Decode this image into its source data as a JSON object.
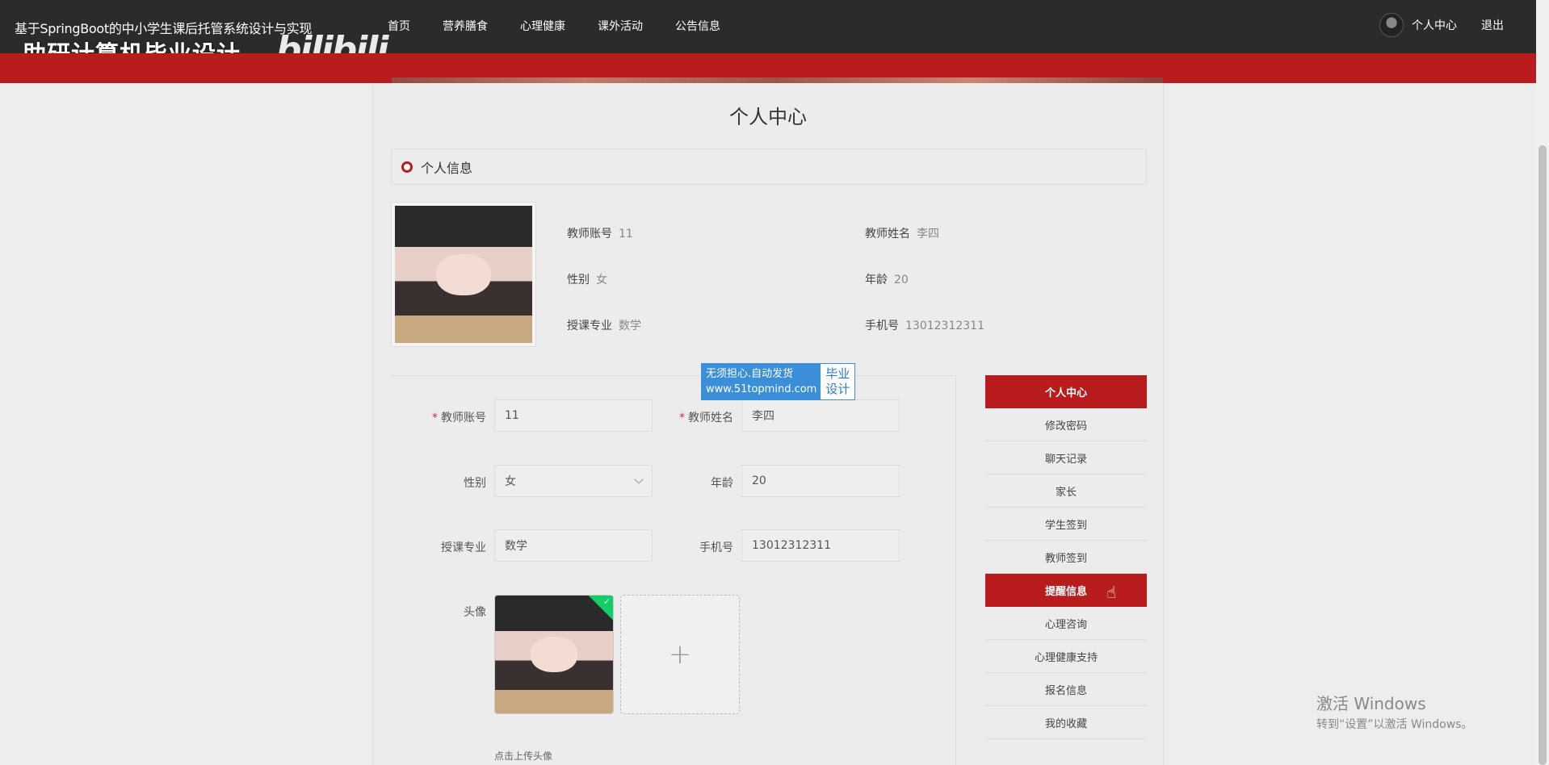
{
  "header": {
    "site_title": "基于SpringBoot的中小学生课后托管系统设计与实现",
    "overlay_watermark": "助研计算机毕业设计",
    "overlay_logo": "bilibili",
    "nav": [
      "首页",
      "营养膳食",
      "心理健康",
      "课外活动",
      "公告信息"
    ],
    "user_center": "个人中心",
    "logout": "退出"
  },
  "page": {
    "title": "个人中心",
    "section_title": "个人信息"
  },
  "info": {
    "account_label": "教师账号",
    "account_value": "11",
    "name_label": "教师姓名",
    "name_value": "李四",
    "gender_label": "性别",
    "gender_value": "女",
    "age_label": "年龄",
    "age_value": "20",
    "major_label": "授课专业",
    "major_value": "数学",
    "phone_label": "手机号",
    "phone_value": "13012312311"
  },
  "form": {
    "account_label": "教师账号",
    "account_value": "11",
    "name_label": "教师姓名",
    "name_value": "李四",
    "gender_label": "性别",
    "gender_value": "女",
    "age_label": "年龄",
    "age_value": "20",
    "major_label": "授课专业",
    "major_value": "数学",
    "phone_label": "手机号",
    "phone_value": "13012312311",
    "avatar_label": "头像",
    "upload_hint": "点击上传头像",
    "add_symbol": "+"
  },
  "ad_badge": {
    "line1": "无须担心.自动发货",
    "line2": "www.51topmind.com",
    "right1": "毕业",
    "right2": "设计"
  },
  "side_menu": [
    {
      "label": "个人中心",
      "active": true
    },
    {
      "label": "修改密码",
      "active": false
    },
    {
      "label": "聊天记录",
      "active": false
    },
    {
      "label": "家长",
      "active": false
    },
    {
      "label": "学生签到",
      "active": false
    },
    {
      "label": "教师签到",
      "active": false
    },
    {
      "label": "提醒信息",
      "active": true
    },
    {
      "label": "心理咨询",
      "active": false
    },
    {
      "label": "心理健康支持",
      "active": false
    },
    {
      "label": "报名信息",
      "active": false
    },
    {
      "label": "我的收藏",
      "active": false
    }
  ],
  "windows": {
    "line1": "激活 Windows",
    "line2": "转到“设置”以激活 Windows。"
  },
  "colors": {
    "accent": "#b81c1c",
    "topbar": "#2b2b2b",
    "success": "#13ce66"
  }
}
